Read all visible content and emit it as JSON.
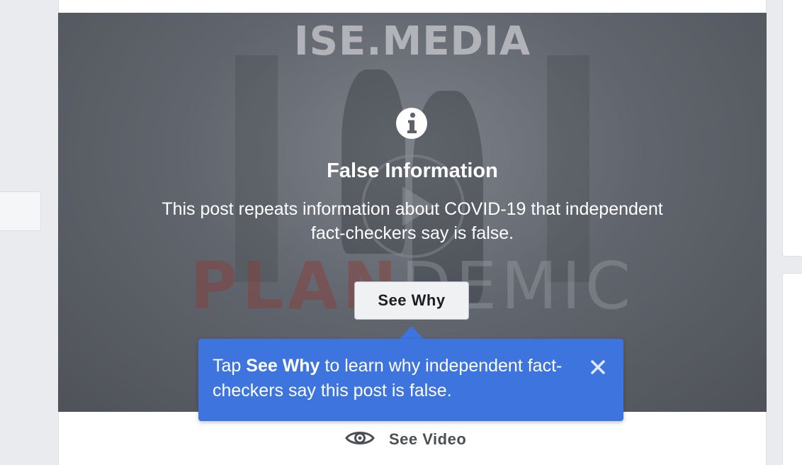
{
  "media": {
    "brand_watermark": "ISE.MEDIA",
    "film_title_red": "PLAN",
    "film_title_rest": "DEMIC"
  },
  "warning": {
    "icon": "info-icon",
    "title": "False Information",
    "body": "This post repeats information about COVID-19 that independent fact-checkers say is false.",
    "button_label": "See Why"
  },
  "tooltip": {
    "prefix": "Tap ",
    "bold": "See Why",
    "suffix": " to learn why independent fact-checkers say this post is false.",
    "close_icon": "close-icon"
  },
  "see_video": {
    "icon": "eye-icon",
    "label": "See Video"
  },
  "colors": {
    "tooltip_bg": "#3e74de",
    "overlay_bg": "#61656d",
    "page_bg": "#e9ebee"
  }
}
